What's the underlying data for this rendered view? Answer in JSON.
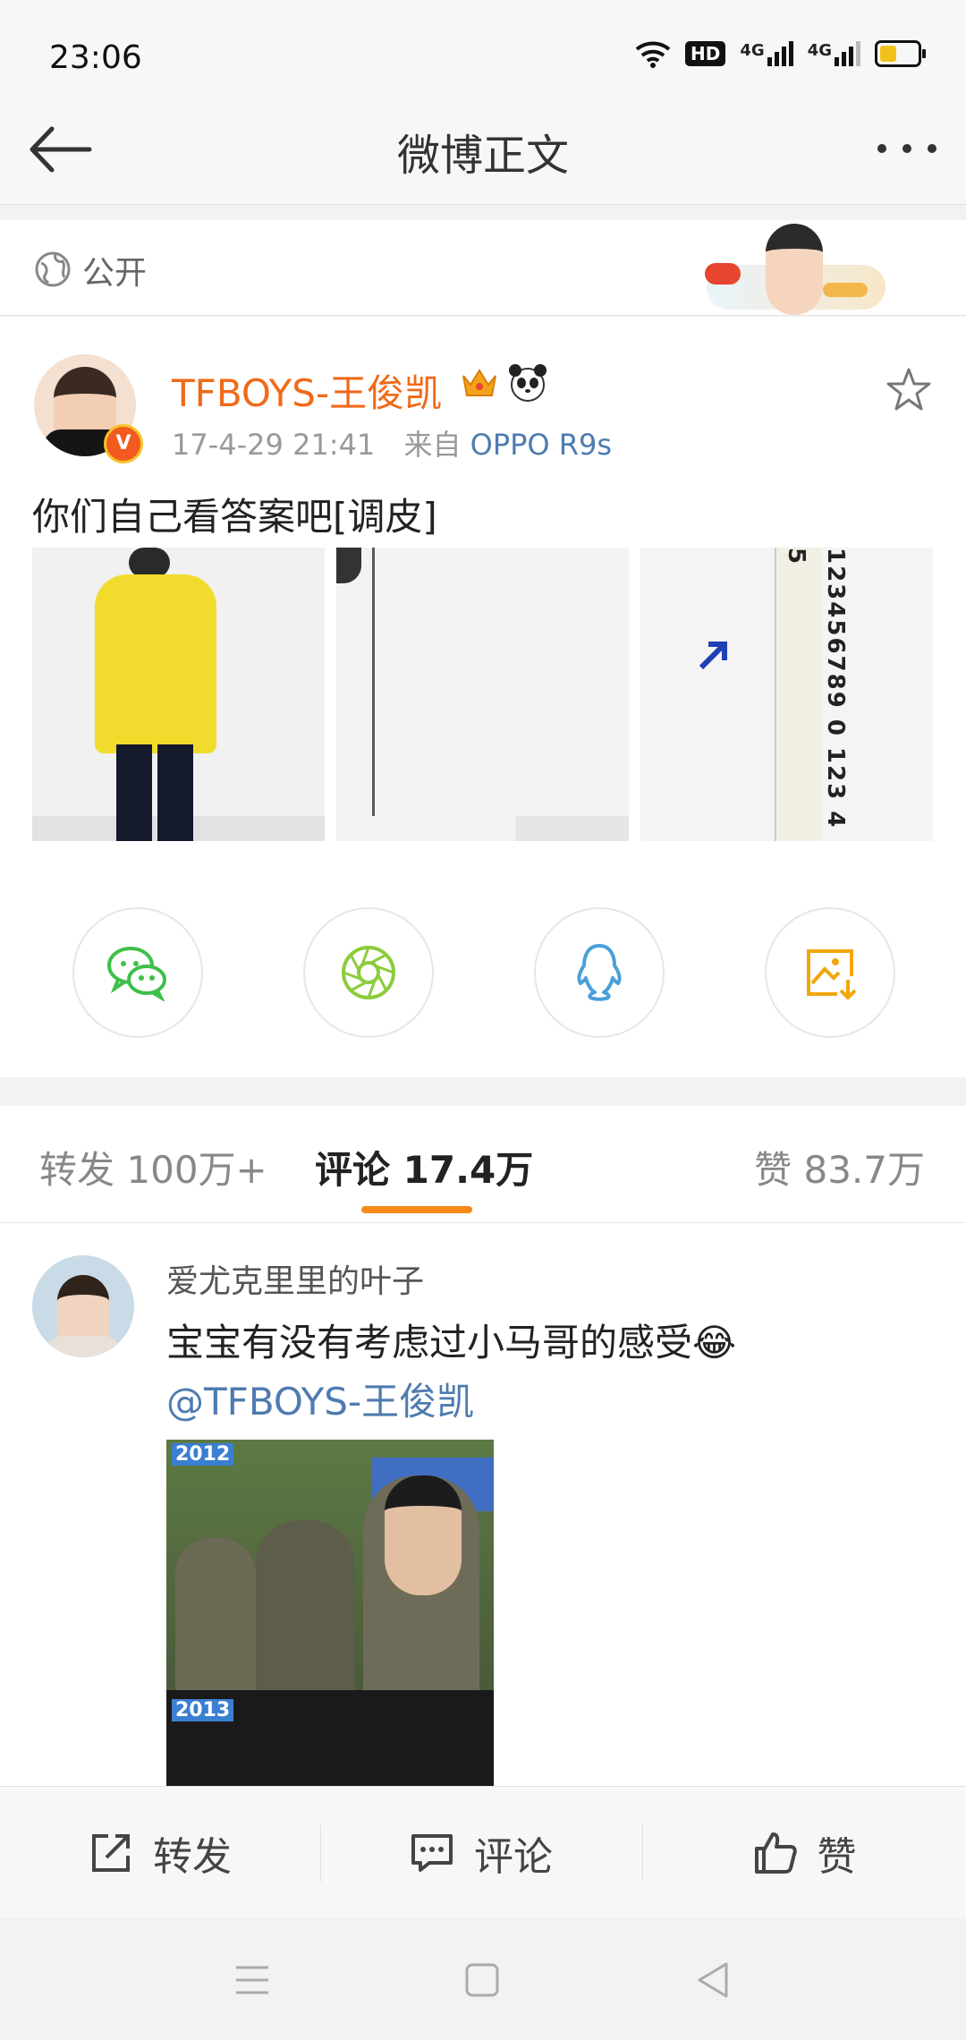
{
  "status": {
    "time": "23:06",
    "hd_badge": "HD",
    "net1": "4G",
    "net2": "4G"
  },
  "nav": {
    "title": "微博正文"
  },
  "privacy": {
    "label": "公开"
  },
  "post": {
    "author": "TFBOYS-王俊凯",
    "date": "17-4-29 21:41",
    "source_prefix": "来自",
    "source": "OPPO R9s",
    "text": "你们自己看答案吧[调皮]",
    "ruler_digits": "123456789 0 123 4 5"
  },
  "stats": {
    "repost_label": "转发",
    "repost_count": "100万+",
    "comment_label": "评论",
    "comment_count": "17.4万",
    "like_label": "赞",
    "like_count": "83.7万"
  },
  "comment": {
    "user": "爱尤克里里的叶子",
    "text": "宝宝有没有考虑过小马哥的感受😂",
    "mention": "@TFBOYS-王俊凯",
    "year1": "2012",
    "year2": "2013"
  },
  "actions": {
    "repost": "转发",
    "comment": "评论",
    "like": "赞"
  },
  "colors": {
    "orange": "#f06a18",
    "link": "#4e7bb0",
    "wechat": "#3fbf4a",
    "moments": "#8ccc3c",
    "qq": "#4aa0d8",
    "save": "#f2a60c"
  }
}
